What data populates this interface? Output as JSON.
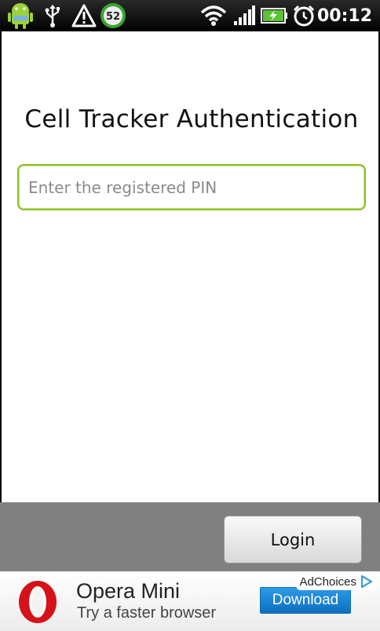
{
  "status_bar": {
    "time": "00:12",
    "battery_badge": "52",
    "icons": [
      "android-debug-icon",
      "usb-icon",
      "warning-icon",
      "battery-level-badge-icon",
      "wifi-icon",
      "signal-icon",
      "battery-charging-icon",
      "alarm-clock-icon"
    ]
  },
  "app": {
    "title": "Cell Tracker Authentication",
    "pin_placeholder": "Enter the registered PIN",
    "pin_value": "",
    "login_label": "Login",
    "accent_color": "#8cbf26"
  },
  "ad": {
    "brand": "Opera Mini",
    "tagline": "Try a faster browser",
    "download_label": "Download",
    "adchoices_label": "AdChoices",
    "brand_color": "#d5121a",
    "button_color": "#1a82d4"
  }
}
